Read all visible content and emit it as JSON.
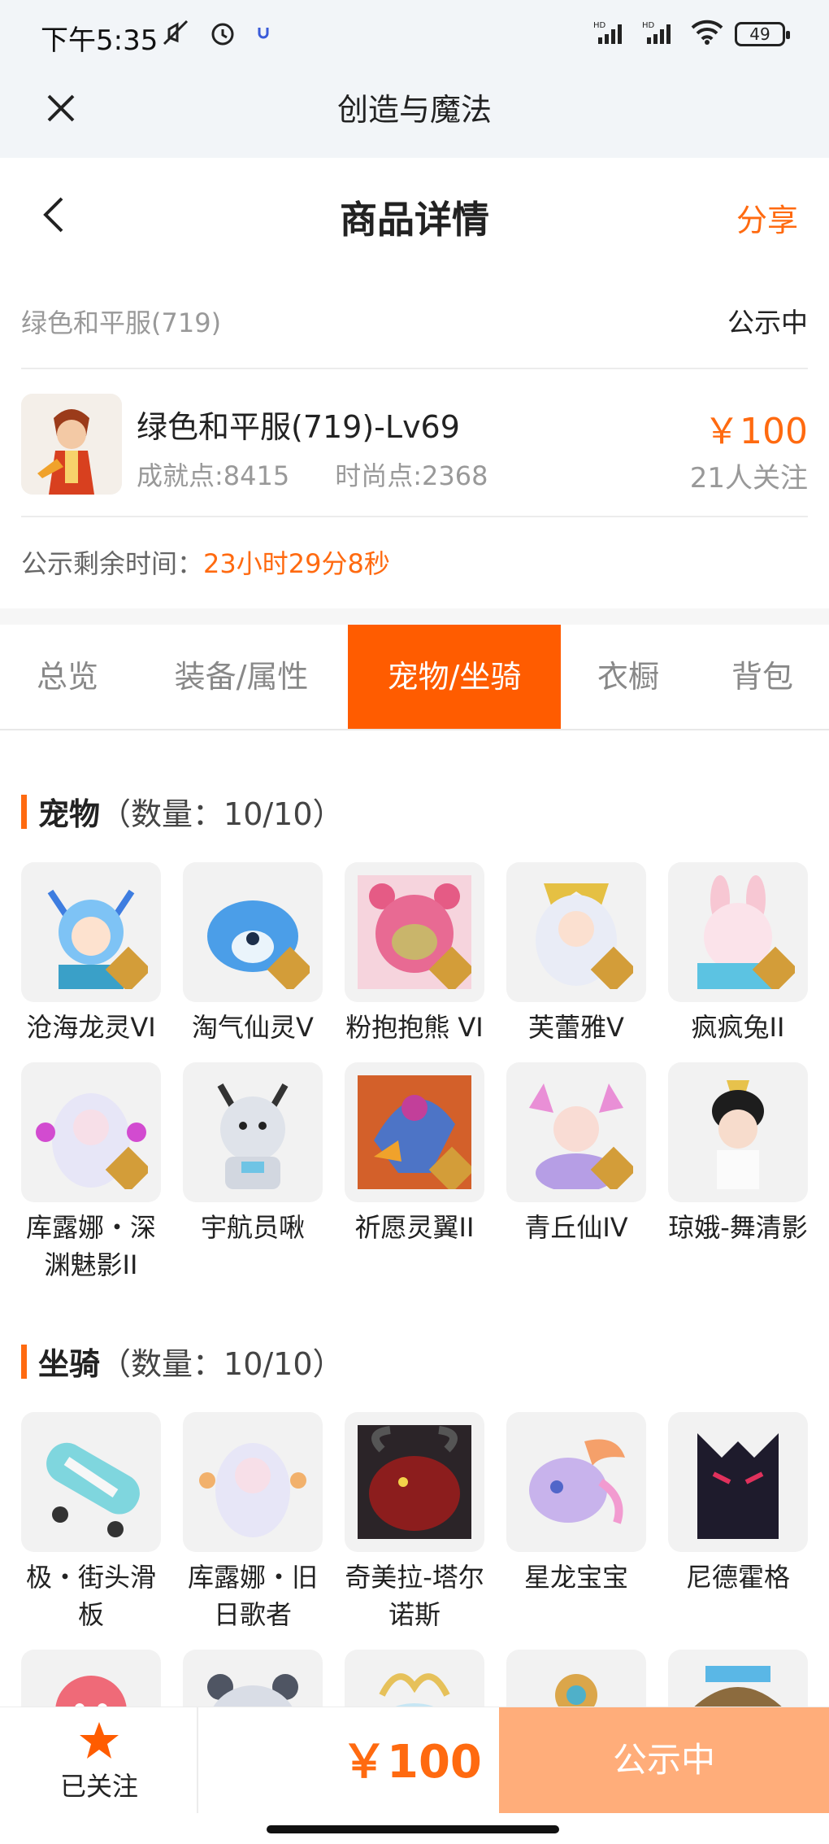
{
  "status": {
    "time": "下午5:35",
    "battery": "49",
    "net1": "HD",
    "net2": "HD"
  },
  "webview": {
    "title": "创造与魔法"
  },
  "header": {
    "title": "商品详情",
    "share": "分享"
  },
  "subheader": {
    "name": "绿色和平服(719)",
    "state": "公示中"
  },
  "product": {
    "name": "绿色和平服(719)-Lv69",
    "achievement": "成就点:8415",
    "fashion": "时尚点:2368",
    "price": "￥100",
    "followers": "21人关注"
  },
  "timer": {
    "label": "公示剩余时间：",
    "value": "23小时29分8秒"
  },
  "tabs": [
    {
      "label": "总览"
    },
    {
      "label": "装备/属性"
    },
    {
      "label": "宠物/坐骑"
    },
    {
      "label": "衣橱"
    },
    {
      "label": "背包"
    }
  ],
  "active_tab": "宠物/坐骑",
  "pets": {
    "title": "宠物",
    "count": "（数量：10/10）",
    "items": [
      {
        "name": "沧海龙灵VI",
        "badge": "VI"
      },
      {
        "name": "淘气仙灵V",
        "badge": "V"
      },
      {
        "name": "粉抱抱熊 VI",
        "badge": "VI"
      },
      {
        "name": "芙蕾雅V",
        "badge": "V"
      },
      {
        "name": "疯疯兔II",
        "badge": "II"
      },
      {
        "name": "库露娜・深渊魅影II",
        "badge": "II"
      },
      {
        "name": "宇航员啾",
        "badge": ""
      },
      {
        "name": "祈愿灵翼II",
        "badge": "II"
      },
      {
        "name": "青丘仙IV",
        "badge": "IV"
      },
      {
        "name": "琼娥-舞清影",
        "badge": ""
      }
    ]
  },
  "mounts": {
    "title": "坐骑",
    "count": "（数量：10/10）",
    "items": [
      {
        "name": "极・街头滑板"
      },
      {
        "name": "库露娜・旧日歌者"
      },
      {
        "name": "奇美拉-塔尔诺斯"
      },
      {
        "name": "星龙宝宝"
      },
      {
        "name": "尼德霍格"
      },
      {
        "name": ""
      },
      {
        "name": ""
      },
      {
        "name": ""
      },
      {
        "name": ""
      },
      {
        "name": ""
      }
    ]
  },
  "bottom": {
    "follow": "已关注",
    "price": "￥100",
    "button": "公示中"
  },
  "colors": {
    "accent": "#ff6a10",
    "tab_active": "#ff5c00",
    "button": "#ffad7a"
  }
}
